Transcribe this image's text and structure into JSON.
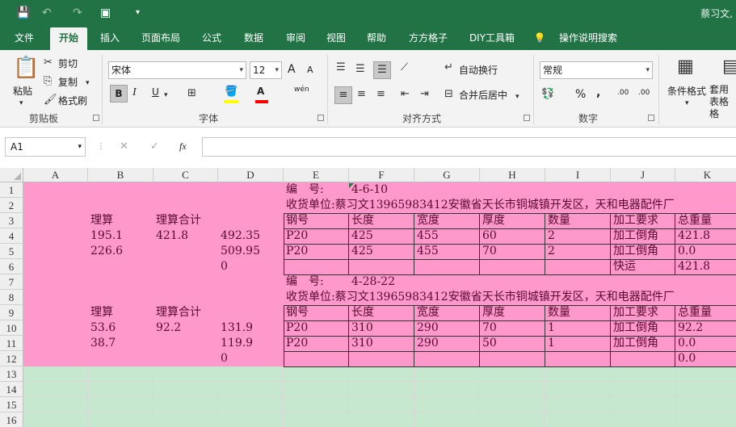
{
  "titlebar": {
    "user": "蔡习文,"
  },
  "tabs": [
    {
      "label": "文件"
    },
    {
      "label": "开始"
    },
    {
      "label": "插入"
    },
    {
      "label": "页面布局"
    },
    {
      "label": "公式"
    },
    {
      "label": "数据"
    },
    {
      "label": "审阅"
    },
    {
      "label": "视图"
    },
    {
      "label": "帮助"
    },
    {
      "label": "方方格子"
    },
    {
      "label": "DIY工具箱"
    },
    {
      "label": "操作说明搜索"
    }
  ],
  "ribbon": {
    "clipboard": {
      "paste": "粘贴",
      "cut": "剪切",
      "copy": "复制",
      "format_painter": "格式刷",
      "label": "剪贴板"
    },
    "font": {
      "name": "宋体",
      "size": "12",
      "label": "字体",
      "bold": "B",
      "italic": "I",
      "underline": "U",
      "grow": "A",
      "shrink": "A",
      "pinyin": "wén",
      "font_color": "A"
    },
    "alignment": {
      "wrap": "自动换行",
      "merge": "合并后居中",
      "label": "对齐方式"
    },
    "number": {
      "format": "常规",
      "percent": "%",
      "comma": ",",
      "inc_dec": ".00",
      "dec_dec": ".00",
      "label": "数字"
    },
    "styles": {
      "cond_format": "条件格式",
      "table_format": "套用表格格"
    }
  },
  "formula_bar": {
    "name_box": "A1",
    "fx": "fx",
    "value": ""
  },
  "columns": [
    "A",
    "B",
    "C",
    "D",
    "E",
    "F",
    "G",
    "H",
    "I",
    "J",
    "K"
  ],
  "rows": [
    "1",
    "2",
    "3",
    "4",
    "5",
    "6",
    "7",
    "8",
    "9",
    "10",
    "11",
    "12",
    "13",
    "14",
    "15",
    "16"
  ],
  "sheet": {
    "block1": {
      "bianhao_label": "编　号:",
      "bianhao_value": "4-6-10",
      "recipient": "收货单位:蔡习文13965983412安徽省天长市铜城镇开发区，天和电器配件厂",
      "calc_header": "理算",
      "calc_total_header": "理算合计",
      "calc": [
        {
          "b": "195.1",
          "c": "421.8",
          "d": "492.35"
        },
        {
          "b": "226.6",
          "c": "",
          "d": "509.95"
        }
      ],
      "d_extra": "0",
      "headers": [
        "钢号",
        "长度",
        "宽度",
        "厚度",
        "数量",
        "加工要求",
        "总重量"
      ],
      "rows": [
        [
          "P20",
          "425",
          "455",
          "60",
          "2",
          "加工倒角",
          "421.8"
        ],
        [
          "P20",
          "425",
          "455",
          "70",
          "2",
          "加工倒角",
          "0.0"
        ]
      ],
      "footer_label": "快运",
      "footer_total": "421.8"
    },
    "block2": {
      "bianhao_label": "编　号:",
      "bianhao_value": "4-28-22",
      "recipient": "收货单位:蔡习文13965983412安徽省天长市铜城镇开发区，天和电器配件厂",
      "calc_header": "理算",
      "calc_total_header": "理算合计",
      "calc": [
        {
          "b": "53.6",
          "c": "92.2",
          "d": "131.9"
        },
        {
          "b": "38.7",
          "c": "",
          "d": "119.9"
        }
      ],
      "d_extra": "0",
      "headers": [
        "钢号",
        "长度",
        "宽度",
        "厚度",
        "数量",
        "加工要求",
        "总重量"
      ],
      "rows": [
        [
          "P20",
          "310",
          "290",
          "70",
          "1",
          "加工倒角",
          "92.2"
        ],
        [
          "P20",
          "310",
          "290",
          "50",
          "1",
          "加工倒角",
          "0.0"
        ]
      ],
      "footer_label": "",
      "footer_total": "0.0"
    }
  },
  "colors": {
    "excel_green": "#217346",
    "pink_fill": "#ff99cc",
    "green_fill": "#c6e8cf"
  }
}
